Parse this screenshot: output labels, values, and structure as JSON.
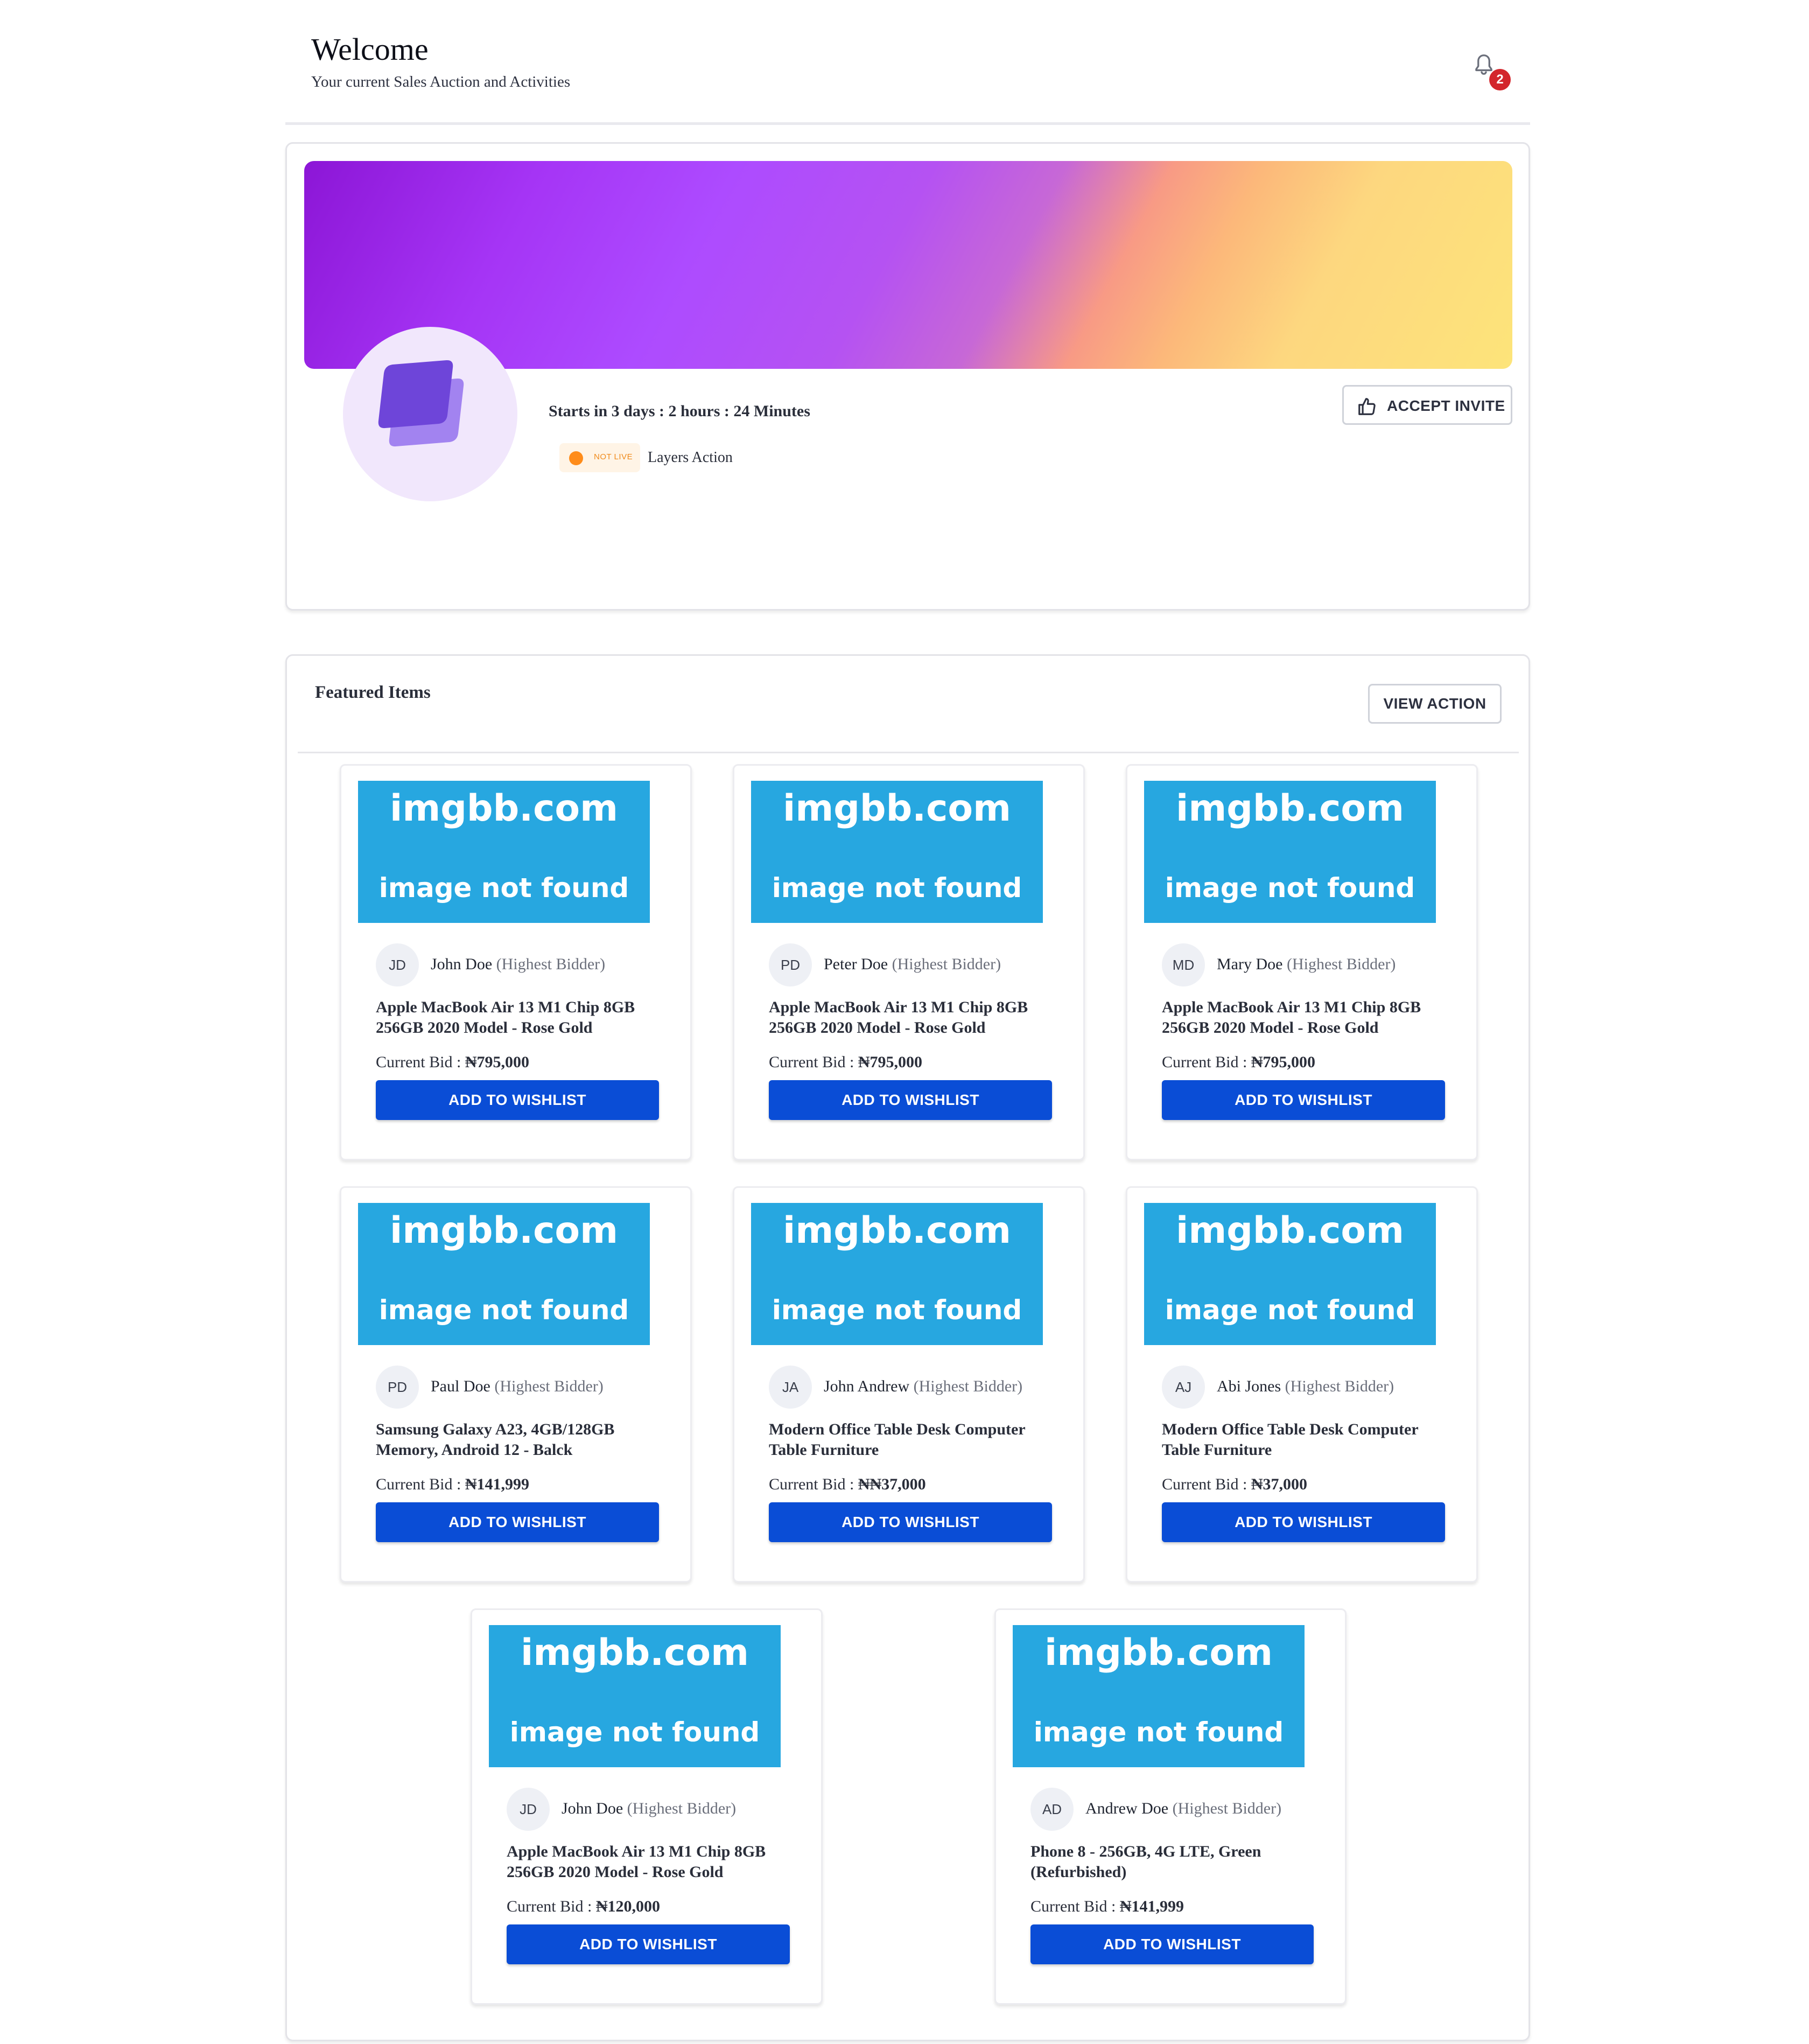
{
  "header": {
    "title": "Welcome",
    "subtitle": "Your current Sales Auction and Activities",
    "notifications_count": "2"
  },
  "auction": {
    "countdown": "Starts in 3 days : 2 hours : 24 Minutes",
    "status": "NOT LIVE",
    "name": "Layers Action",
    "accept_label": "ACCEPT INVITE"
  },
  "featured": {
    "title": "Featured Items",
    "view_label": "VIEW ACTION",
    "placeholder_top": "imgbb.com",
    "placeholder_bottom": "image not found",
    "highest_bidder_tag": "(Highest Bidder)",
    "current_bid_label": "Current Bid :",
    "wishlist_label": "ADD TO WISHLIST",
    "items": [
      {
        "initials": "JD",
        "bidder": "John Doe",
        "title": "Apple MacBook Air 13 M1 Chip 8GB 256GB 2020 Model - Rose Gold",
        "bid": "₦795,000"
      },
      {
        "initials": "PD",
        "bidder": "Peter Doe",
        "title": "Apple MacBook Air 13 M1 Chip 8GB 256GB 2020 Model - Rose Gold",
        "bid": "₦795,000"
      },
      {
        "initials": "MD",
        "bidder": "Mary Doe",
        "title": "Apple MacBook Air 13 M1 Chip 8GB 256GB 2020 Model - Rose Gold",
        "bid": "₦795,000"
      },
      {
        "initials": "PD",
        "bidder": "Paul Doe",
        "title": "Samsung Galaxy A23, 4GB/128GB Memory, Android 12 - Balck",
        "bid": "₦141,999"
      },
      {
        "initials": "JA",
        "bidder": "John Andrew",
        "title": "Modern Office Table Desk Computer Table Furniture",
        "bid": "₦₦37,000"
      },
      {
        "initials": "AJ",
        "bidder": "Abi Jones",
        "title": "Modern Office Table Desk Computer Table Furniture",
        "bid": "₦37,000"
      },
      {
        "initials": "JD",
        "bidder": "John Doe",
        "title": "Apple MacBook Air 13 M1 Chip 8GB 256GB 2020 Model - Rose Gold",
        "bid": "₦120,000"
      },
      {
        "initials": "AD",
        "bidder": "Andrew Doe",
        "title": "Phone 8 - 256GB, 4G LTE, Green (Refurbished)",
        "bid": "₦141,999"
      }
    ]
  }
}
